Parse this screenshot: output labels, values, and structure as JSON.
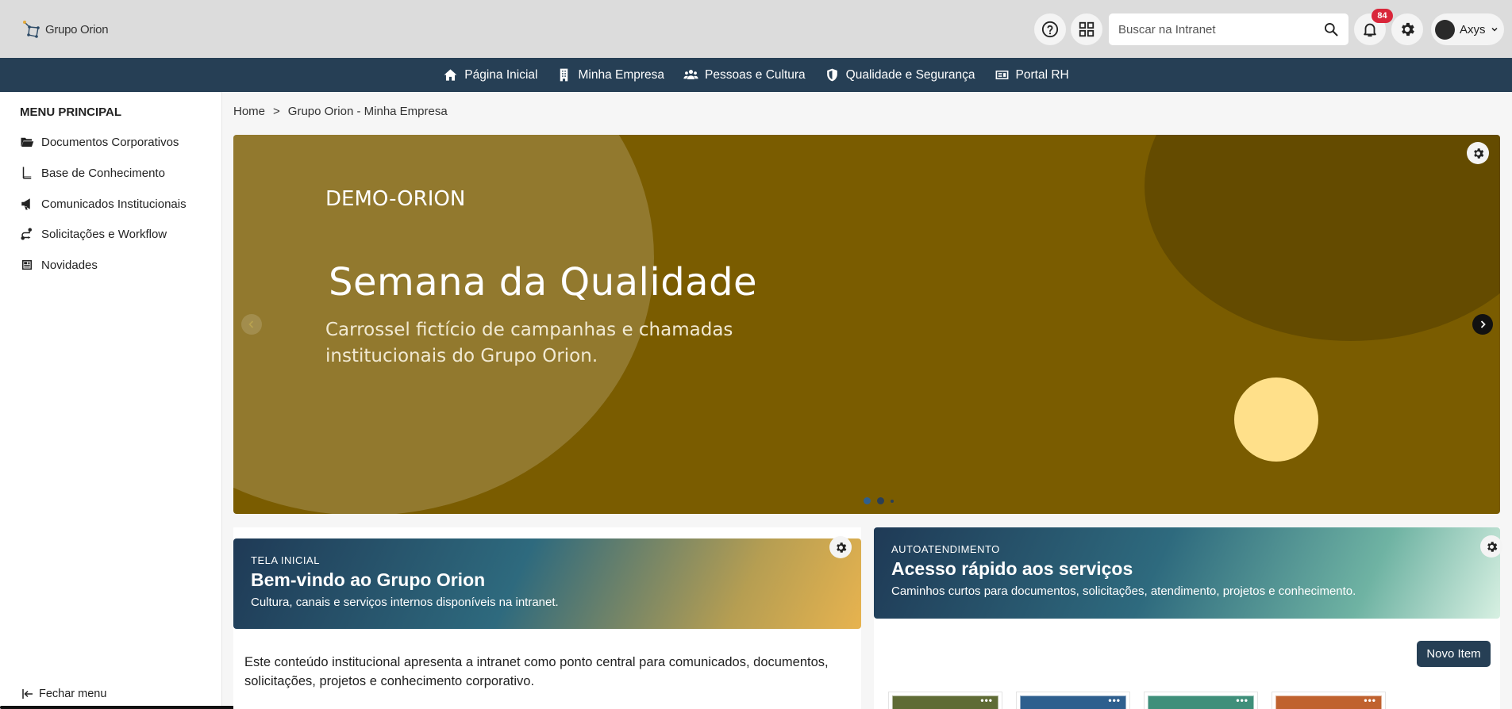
{
  "header": {
    "logo_text": "Grupo Orion",
    "search_placeholder": "Buscar na Intranet",
    "notification_count": "84",
    "user_name": "Axys"
  },
  "nav": {
    "items": [
      {
        "label": "Página Inicial",
        "icon": "home-icon"
      },
      {
        "label": "Minha Empresa",
        "icon": "building-icon"
      },
      {
        "label": "Pessoas e Cultura",
        "icon": "people-icon"
      },
      {
        "label": "Qualidade e Segurança",
        "icon": "shield-icon"
      },
      {
        "label": "Portal RH",
        "icon": "id-card-icon"
      }
    ]
  },
  "sidebar": {
    "title": "MENU PRINCIPAL",
    "items": [
      {
        "label": "Documentos Corporativos",
        "icon": "folder-open-icon"
      },
      {
        "label": "Base de Conhecimento",
        "icon": "book-icon"
      },
      {
        "label": "Comunicados Institucionais",
        "icon": "megaphone-icon"
      },
      {
        "label": "Solicitações e Workflow",
        "icon": "workflow-icon"
      },
      {
        "label": "Novidades",
        "icon": "newspaper-icon"
      }
    ],
    "close_label": "Fechar menu"
  },
  "breadcrumb": {
    "home": "Home",
    "separator": ">",
    "current": "Grupo Orion - Minha Empresa"
  },
  "hero": {
    "label": "DEMO-ORION",
    "title": "Semana da Qualidade",
    "subtitle": "Carrossel fictício de campanhas e chamadas institucionais do Grupo Orion.",
    "background_color": "#7a5c00",
    "active_slide": 1,
    "slide_count": 3
  },
  "welcome_card": {
    "kicker": "TELA INICIAL",
    "title": "Bem-vindo ao Grupo Orion",
    "description": "Cultura, canais e serviços internos disponíveis na intranet.",
    "body": "Este conteúdo institucional apresenta a intranet como ponto central para comunicados, documentos, solicitações, projetos e conhecimento corporativo."
  },
  "services_card": {
    "kicker": "AUTOATENDIMENTO",
    "title": "Acesso rápido aos serviços",
    "description": "Caminhos curtos para documentos, solicitações, atendimento, projetos e conhecimento.",
    "new_button": "Novo Item",
    "tile_colors": [
      "#5f6b35",
      "#2e5f8e",
      "#3f8f7a",
      "#c0622f"
    ]
  },
  "colors": {
    "navbar": "#263f55",
    "header": "#dcdcdc",
    "badge": "#d9263a"
  }
}
